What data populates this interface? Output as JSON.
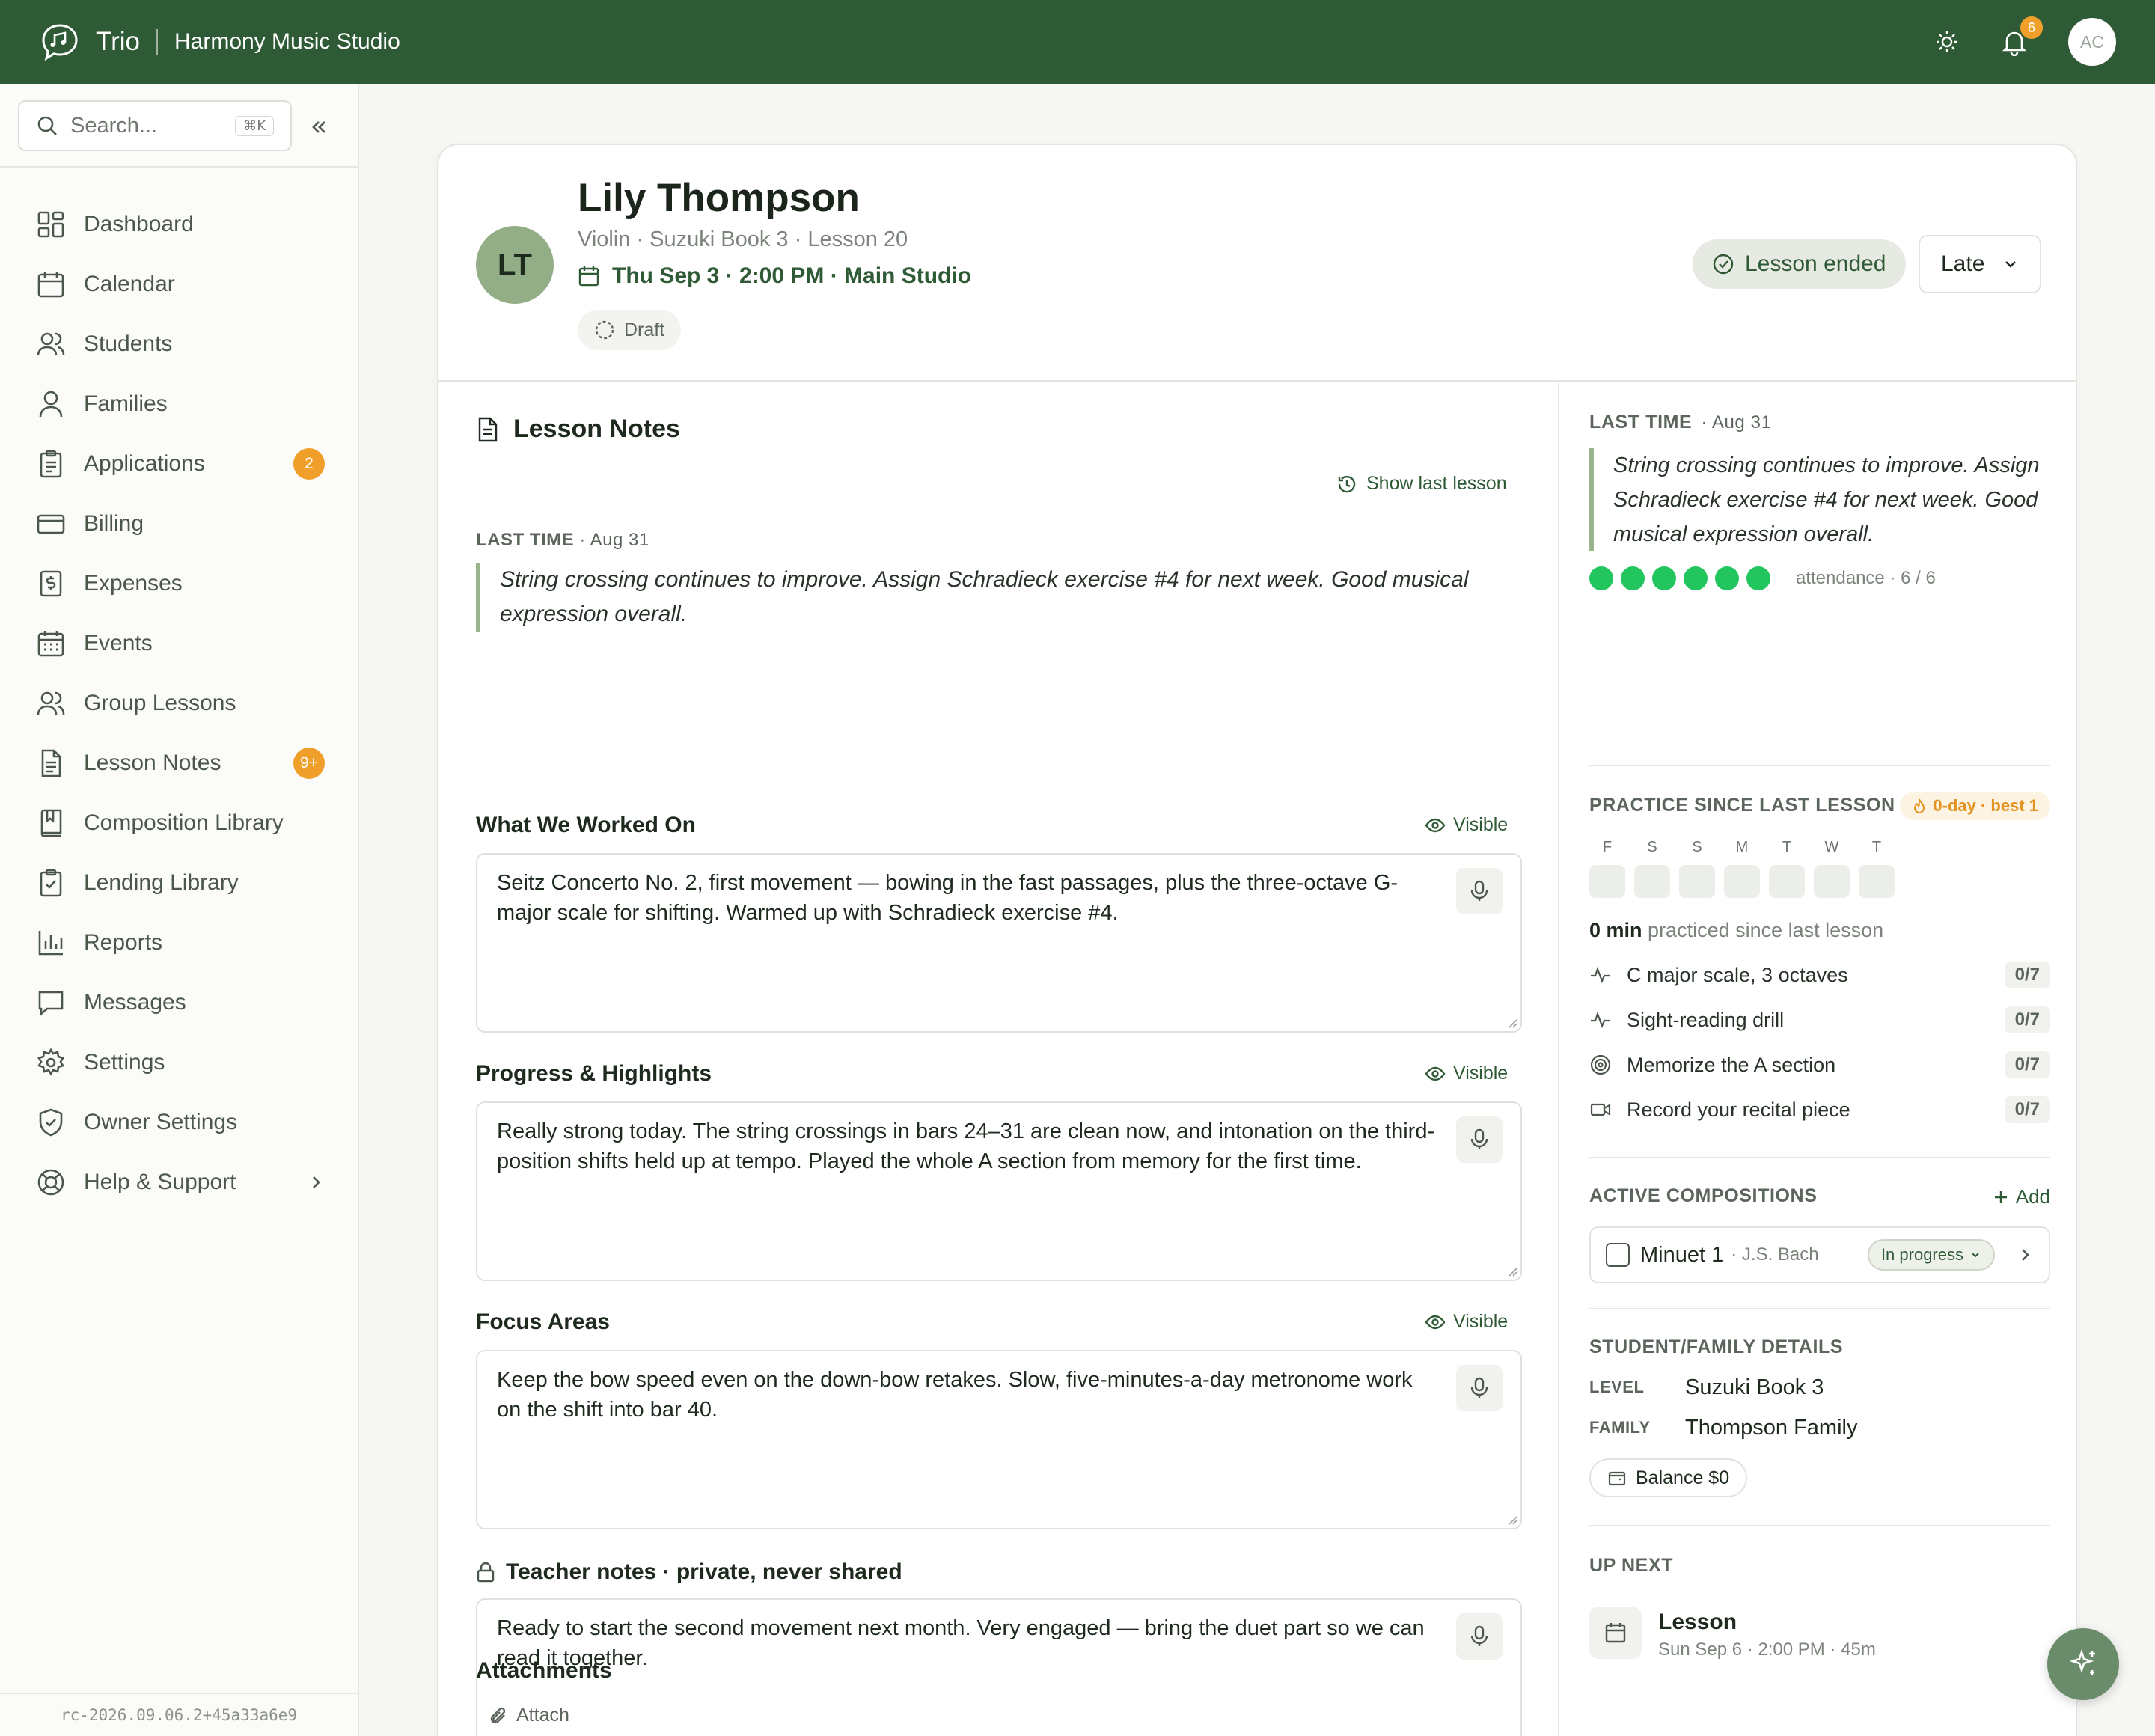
{
  "topbar": {
    "brand": "Trio",
    "studio": "Harmony Music Studio",
    "notification_count": "6",
    "user_initials": "AC"
  },
  "sidebar": {
    "search_placeholder": "Search...",
    "search_shortcut": "⌘K",
    "items": [
      {
        "label": "Dashboard",
        "icon": "dashboard-icon"
      },
      {
        "label": "Calendar",
        "icon": "calendar-icon"
      },
      {
        "label": "Students",
        "icon": "users-icon"
      },
      {
        "label": "Families",
        "icon": "user-icon"
      },
      {
        "label": "Applications",
        "icon": "clipboard-icon",
        "badge": "2"
      },
      {
        "label": "Billing",
        "icon": "credit-card-icon"
      },
      {
        "label": "Expenses",
        "icon": "receipt-icon"
      },
      {
        "label": "Events",
        "icon": "calendar-grid-icon"
      },
      {
        "label": "Group Lessons",
        "icon": "group-icon"
      },
      {
        "label": "Lesson Notes",
        "icon": "document-icon",
        "badge": "9+"
      },
      {
        "label": "Composition Library",
        "icon": "book-icon"
      },
      {
        "label": "Lending Library",
        "icon": "clipboard-check-icon"
      },
      {
        "label": "Reports",
        "icon": "bar-chart-icon"
      },
      {
        "label": "Messages",
        "icon": "message-icon"
      },
      {
        "label": "Settings",
        "icon": "gear-icon"
      },
      {
        "label": "Owner Settings",
        "icon": "shield-icon"
      },
      {
        "label": "Help & Support",
        "icon": "lifebuoy-icon"
      }
    ],
    "version": "rc-2026.09.06.2+45a33a6e9"
  },
  "lesson": {
    "initials": "LT",
    "student_name": "Lily Thompson",
    "subtitle": "Violin · Suzuki Book 3 · Lesson 20",
    "when": "Thu Sep 3 · 2:00 PM · Main Studio",
    "draft": "Draft",
    "status": "Lesson ended",
    "attendance_select": "Late"
  },
  "notes": {
    "title": "Lesson Notes",
    "show_last": "Show last lesson",
    "last_time_label": "LAST TIME",
    "last_time_date": "· Aug 31",
    "last_time_text": "String crossing continues to improve. Assign Schradieck exercise #4 for next week. Good musical expression overall.",
    "visible_label": "Visible",
    "fields": [
      {
        "label": "What We Worked On",
        "text": "Seitz Concerto No. 2, first movement — bowing in the fast passages, plus the three-octave G-major scale for shifting. Warmed up with Schradieck exercise #4."
      },
      {
        "label": "Progress & Highlights",
        "text": "Really strong today. The string crossings in bars 24–31 are clean now, and intonation on the third-position shifts held up at tempo. Played the whole A section from memory for the first time."
      },
      {
        "label": "Focus Areas",
        "text": "Keep the bow speed even on the down-bow retakes. Slow, five-minutes-a-day metronome work on the shift into bar 40."
      }
    ],
    "teacher_label": "Teacher notes · private, never shared",
    "teacher_text": "Ready to start the second movement next month. Very engaged — bring the duet part so we can read it together.",
    "attachments_label": "Attachments",
    "attach_button": "Attach"
  },
  "right": {
    "last_time_label": "LAST TIME",
    "last_time_date": "· Aug 31",
    "last_time_text": "String crossing continues to improve. Assign Schradieck exercise #4 for next week. Good musical expression overall.",
    "attendance_text": "attendance · 6 / 6",
    "attendance_dots": 6,
    "attendance_color": "#22c55e",
    "practice_label": "PRACTICE SINCE LAST LESSON",
    "streak": "0-day · best 1",
    "days": [
      "F",
      "S",
      "S",
      "M",
      "T",
      "W",
      "T"
    ],
    "practiced_value": "0 min",
    "practiced_text": "practiced since last lesson",
    "assignments": [
      {
        "label": "C major scale, 3 octaves",
        "count": "0/7",
        "icon": "activity-icon"
      },
      {
        "label": "Sight-reading drill",
        "count": "0/7",
        "icon": "activity-icon"
      },
      {
        "label": "Memorize the A section",
        "count": "0/7",
        "icon": "target-icon"
      },
      {
        "label": "Record your recital piece",
        "count": "0/7",
        "icon": "video-icon"
      }
    ],
    "compositions_label": "ACTIVE COMPOSITIONS",
    "add_label": "Add",
    "composition": {
      "title": "Minuet 1",
      "composer": "· J.S. Bach",
      "status": "In progress"
    },
    "details_label": "STUDENT/FAMILY DETAILS",
    "level_key": "LEVEL",
    "level_value": "Suzuki Book 3",
    "family_key": "FAMILY",
    "family_value": "Thompson Family",
    "balance": "Balance $0",
    "up_next_label": "UP NEXT",
    "next_title": "Lesson",
    "next_sub": "Sun Sep 6 · 2:00 PM · 45m"
  },
  "colors": {
    "brand_green": "#2f5a36",
    "badge_orange": "#f0a02a",
    "avatar_green": "#93ae86"
  }
}
